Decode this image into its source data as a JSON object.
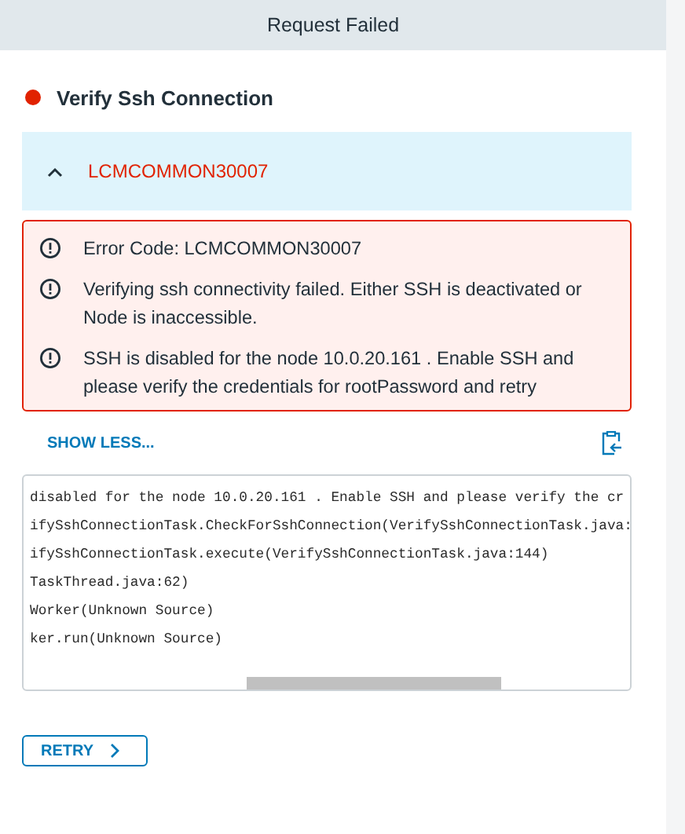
{
  "header": {
    "title": "Request Failed"
  },
  "task": {
    "name": "Verify Ssh Connection",
    "color": "#e12200"
  },
  "error_group": {
    "code": "LCMCOMMON30007",
    "expanded": true,
    "messages": [
      "Error Code: LCMCOMMON30007",
      "Verifying ssh connectivity failed. Either SSH is deactivated or Node is inaccessible.",
      "SSH is disabled for the node 10.0.20.161 . Enable SSH and please verify the credentials for rootPassword and retry"
    ]
  },
  "show_less": "SHOW LESS...",
  "log_lines": [
    "disabled for the node 10.0.20.161 . Enable SSH and please verify the cr",
    "ifySshConnectionTask.CheckForSshConnection(VerifySshConnectionTask.java:",
    "ifySshConnectionTask.execute(VerifySshConnectionTask.java:144)",
    "TaskThread.java:62)",
    "Worker(Unknown Source)",
    "ker.run(Unknown Source)"
  ],
  "retry_button": "RETRY"
}
